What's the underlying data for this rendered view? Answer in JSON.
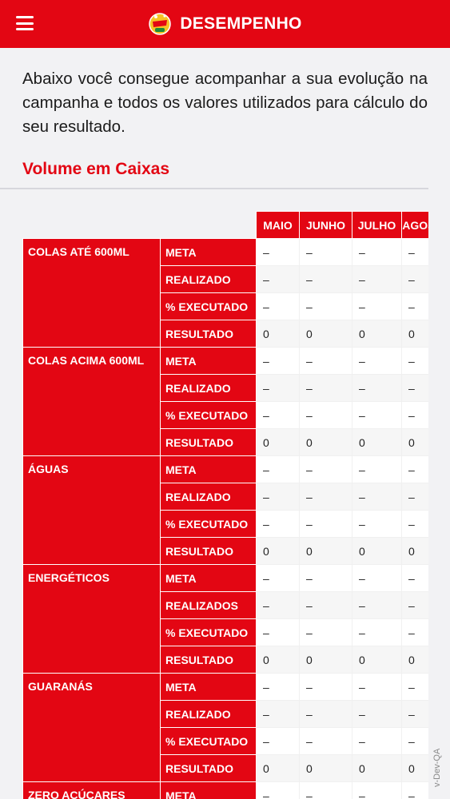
{
  "header": {
    "title": "DESEMPENHO",
    "menu_icon": "hamburger-menu-icon",
    "logo_icon": "campaign-logo-icon"
  },
  "intro_text": "Abaixo você consegue acompanhar a sua evolução na campanha e todos os valores utilizados para cálculo do seu resultado.",
  "section_title": "Volume em Caixas",
  "table": {
    "months": [
      "MAIO",
      "JUNHO",
      "JULHO",
      "AGOSTO"
    ],
    "categories": [
      {
        "name": "COLAS ATÉ 600ML",
        "rows": [
          {
            "label": "META",
            "values": [
              "–",
              "–",
              "–",
              "–"
            ]
          },
          {
            "label": "REALIZADO",
            "values": [
              "–",
              "–",
              "–",
              "–"
            ]
          },
          {
            "label": "% EXECUTADO",
            "values": [
              "–",
              "–",
              "–",
              "–"
            ]
          },
          {
            "label": "RESULTADO",
            "values": [
              "0",
              "0",
              "0",
              "0"
            ]
          }
        ]
      },
      {
        "name": "COLAS ACIMA 600ML",
        "rows": [
          {
            "label": "META",
            "values": [
              "–",
              "–",
              "–",
              "–"
            ]
          },
          {
            "label": "REALIZADO",
            "values": [
              "–",
              "–",
              "–",
              "–"
            ]
          },
          {
            "label": "% EXECUTADO",
            "values": [
              "–",
              "–",
              "–",
              "–"
            ]
          },
          {
            "label": "RESULTADO",
            "values": [
              "0",
              "0",
              "0",
              "0"
            ]
          }
        ]
      },
      {
        "name": "ÁGUAS",
        "rows": [
          {
            "label": "META",
            "values": [
              "–",
              "–",
              "–",
              "–"
            ]
          },
          {
            "label": "REALIZADO",
            "values": [
              "–",
              "–",
              "–",
              "–"
            ]
          },
          {
            "label": "% EXECUTADO",
            "values": [
              "–",
              "–",
              "–",
              "–"
            ]
          },
          {
            "label": "RESULTADO",
            "values": [
              "0",
              "0",
              "0",
              "0"
            ]
          }
        ]
      },
      {
        "name": "ENERGÉTICOS",
        "rows": [
          {
            "label": "META",
            "values": [
              "–",
              "–",
              "–",
              "–"
            ]
          },
          {
            "label": "REALIZADOS",
            "values": [
              "–",
              "–",
              "–",
              "–"
            ]
          },
          {
            "label": "% EXECUTADO",
            "values": [
              "–",
              "–",
              "–",
              "–"
            ]
          },
          {
            "label": "RESULTADO",
            "values": [
              "0",
              "0",
              "0",
              "0"
            ]
          }
        ]
      },
      {
        "name": "GUARANÁS",
        "rows": [
          {
            "label": "META",
            "values": [
              "–",
              "–",
              "–",
              "–"
            ]
          },
          {
            "label": "REALIZADO",
            "values": [
              "–",
              "–",
              "–",
              "–"
            ]
          },
          {
            "label": "% EXECUTADO",
            "values": [
              "–",
              "–",
              "–",
              "–"
            ]
          },
          {
            "label": "RESULTADO",
            "values": [
              "0",
              "0",
              "0",
              "0"
            ]
          }
        ]
      },
      {
        "name": "ZERO AÇÚCARES",
        "rows": [
          {
            "label": "META",
            "values": [
              "–",
              "–",
              "–",
              "–"
            ]
          }
        ]
      }
    ]
  },
  "watermark": "v-Dev-QA",
  "colors": {
    "brand_red": "#e30613",
    "section_title": "#e30613"
  }
}
